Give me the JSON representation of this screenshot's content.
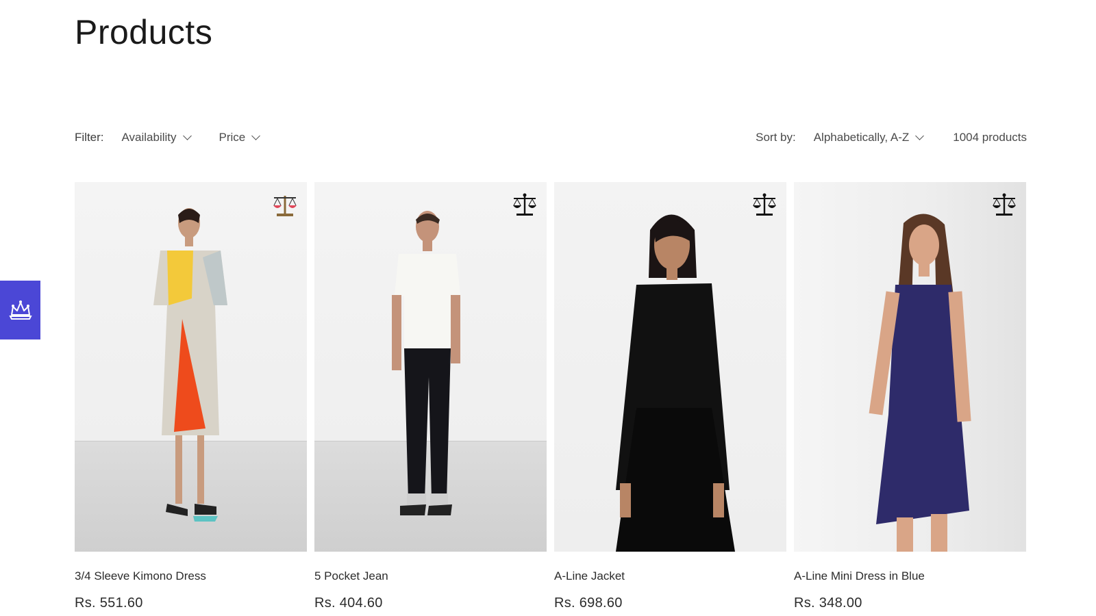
{
  "page": {
    "title": "Products"
  },
  "filters": {
    "label": "Filter:",
    "availability": "Availability",
    "price": "Price"
  },
  "sort": {
    "label": "Sort by:",
    "value": "Alphabetically, A-Z",
    "count": "1004 products"
  },
  "products": [
    {
      "title": "3/4 Sleeve Kimono Dress",
      "price": "Rs. 551.60",
      "compare_icon": "scale-icon-red"
    },
    {
      "title": "5 Pocket Jean",
      "price": "Rs. 404.60",
      "compare_icon": "scale-icon"
    },
    {
      "title": "A-Line Jacket",
      "price": "Rs. 698.60",
      "compare_icon": "scale-icon"
    },
    {
      "title": "A-Line Mini Dress in Blue",
      "price": "Rs. 348.00",
      "compare_icon": "scale-icon"
    }
  ],
  "side_widget": {
    "icon": "crown-icon",
    "color": "#4b47d6"
  }
}
